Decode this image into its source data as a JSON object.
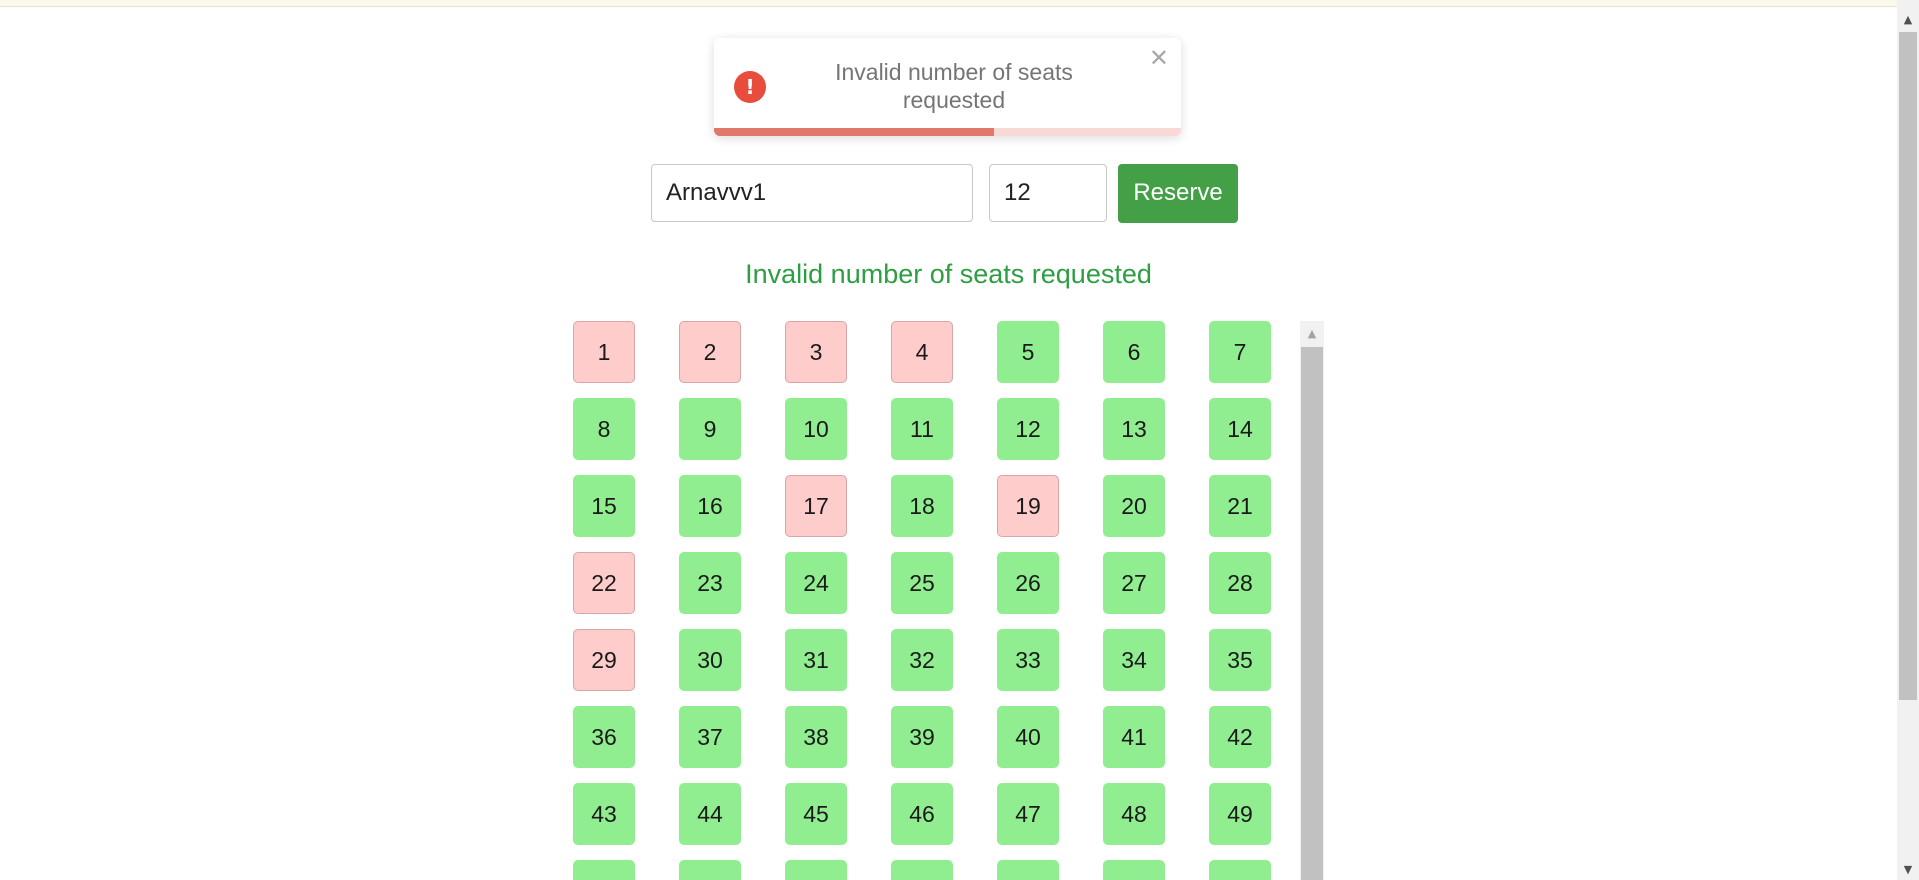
{
  "toast": {
    "message": "Invalid number of seats requested",
    "icon": "error-icon",
    "close_glyph": "✕",
    "accent_color": "#e74c3c",
    "progress_fraction": 0.6
  },
  "form": {
    "name_value": "Arnavvv1",
    "seats_value": "12",
    "reserve_label": "Reserve"
  },
  "status_message": "Invalid number of seats requested",
  "colors": {
    "available": "#90ee90",
    "reserved": "#ffcccc",
    "reserve_button": "#43a047",
    "status_text": "#2e9e43"
  },
  "seats": [
    {
      "number": "1",
      "status": "reserved"
    },
    {
      "number": "2",
      "status": "reserved"
    },
    {
      "number": "3",
      "status": "reserved"
    },
    {
      "number": "4",
      "status": "reserved"
    },
    {
      "number": "5",
      "status": "available"
    },
    {
      "number": "6",
      "status": "available"
    },
    {
      "number": "7",
      "status": "available"
    },
    {
      "number": "8",
      "status": "available"
    },
    {
      "number": "9",
      "status": "available"
    },
    {
      "number": "10",
      "status": "available"
    },
    {
      "number": "11",
      "status": "available"
    },
    {
      "number": "12",
      "status": "available"
    },
    {
      "number": "13",
      "status": "available"
    },
    {
      "number": "14",
      "status": "available"
    },
    {
      "number": "15",
      "status": "available"
    },
    {
      "number": "16",
      "status": "available"
    },
    {
      "number": "17",
      "status": "reserved"
    },
    {
      "number": "18",
      "status": "available"
    },
    {
      "number": "19",
      "status": "reserved"
    },
    {
      "number": "20",
      "status": "available"
    },
    {
      "number": "21",
      "status": "available"
    },
    {
      "number": "22",
      "status": "reserved"
    },
    {
      "number": "23",
      "status": "available"
    },
    {
      "number": "24",
      "status": "available"
    },
    {
      "number": "25",
      "status": "available"
    },
    {
      "number": "26",
      "status": "available"
    },
    {
      "number": "27",
      "status": "available"
    },
    {
      "number": "28",
      "status": "available"
    },
    {
      "number": "29",
      "status": "reserved"
    },
    {
      "number": "30",
      "status": "available"
    },
    {
      "number": "31",
      "status": "available"
    },
    {
      "number": "32",
      "status": "available"
    },
    {
      "number": "33",
      "status": "available"
    },
    {
      "number": "34",
      "status": "available"
    },
    {
      "number": "35",
      "status": "available"
    },
    {
      "number": "36",
      "status": "available"
    },
    {
      "number": "37",
      "status": "available"
    },
    {
      "number": "38",
      "status": "available"
    },
    {
      "number": "39",
      "status": "available"
    },
    {
      "number": "40",
      "status": "available"
    },
    {
      "number": "41",
      "status": "available"
    },
    {
      "number": "42",
      "status": "available"
    },
    {
      "number": "43",
      "status": "available"
    },
    {
      "number": "44",
      "status": "available"
    },
    {
      "number": "45",
      "status": "available"
    },
    {
      "number": "46",
      "status": "available"
    },
    {
      "number": "47",
      "status": "available"
    },
    {
      "number": "48",
      "status": "available"
    },
    {
      "number": "49",
      "status": "available"
    },
    {
      "number": "",
      "status": "available"
    },
    {
      "number": "",
      "status": "available"
    },
    {
      "number": "",
      "status": "available"
    },
    {
      "number": "",
      "status": "available"
    },
    {
      "number": "",
      "status": "available"
    },
    {
      "number": "",
      "status": "available"
    },
    {
      "number": "",
      "status": "available"
    }
  ]
}
